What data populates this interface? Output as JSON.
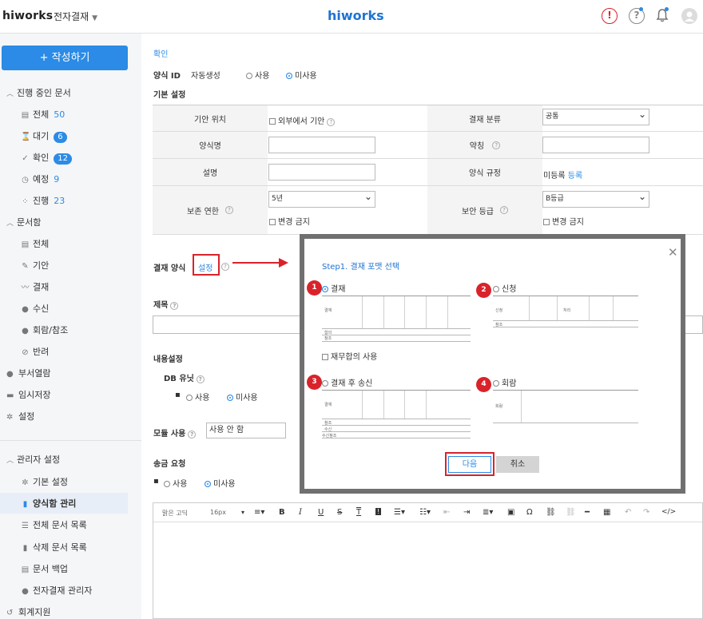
{
  "header": {
    "logo": "hiworks",
    "app_menu": "전자결재",
    "center_logo": "hiworks"
  },
  "sidebar": {
    "write_button": "+ 작성하기",
    "in_progress": {
      "title": "진행 중인 문서",
      "items": [
        {
          "label": "전체",
          "count": "50"
        },
        {
          "label": "대기",
          "count": "6"
        },
        {
          "label": "확인",
          "count": "12"
        },
        {
          "label": "예정",
          "count": "9"
        },
        {
          "label": "진행",
          "count": "23"
        }
      ]
    },
    "document_box": {
      "title": "문서함",
      "items": [
        "전체",
        "기안",
        "결재",
        "수신",
        "회람/참조",
        "반려"
      ]
    },
    "top_items": [
      "부서열람",
      "임시저장",
      "설정"
    ],
    "admin": {
      "title": "관리자 설정",
      "items": [
        "기본 설정",
        "양식함 관리",
        "전체 문서 목록",
        "삭제 문서 목록",
        "문서 백업",
        "전자결재 관리자"
      ]
    },
    "bottom_item": "회계지원"
  },
  "main": {
    "confirm_link": "확인",
    "form_id_label": "양식 ID",
    "form_id_auto": "자동생성",
    "use": "사용",
    "not_use": "미사용",
    "basic_settings": "기본 설정",
    "table": {
      "draft_location": "기안 위치",
      "external_draft": "외부에서 기안",
      "approval_category": "결재 분류",
      "approval_category_value": "공통",
      "form_name": "양식명",
      "abbreviation": "약칭",
      "description": "설명",
      "form_rule": "양식 규정",
      "unregistered": "미등록",
      "register": "등록",
      "retention": "보존 연한",
      "retention_value": "5년",
      "no_change": "변경 금지",
      "security": "보안 등급",
      "security_value": "B등급"
    },
    "approval_format": "결재 양식",
    "settings_link": "설정",
    "title_label": "제목",
    "content_settings": "내용설정",
    "db_unit": "DB 유닛",
    "module_use": "모듈 사용",
    "module_value": "사용 안 함",
    "remit_request": "송금 요청",
    "editor": {
      "font": "맑은 고딕",
      "size": "16px"
    }
  },
  "modal": {
    "title": "Step1. 결재 포맷 선택",
    "options": [
      {
        "num": "1",
        "label": "결재"
      },
      {
        "num": "2",
        "label": "신청"
      },
      {
        "num": "3",
        "label": "결재 후 송신"
      },
      {
        "num": "4",
        "label": "회람"
      }
    ],
    "financial_agreement": "재무합의 사용",
    "preview_labels": {
      "approval": "결재",
      "agreement": "합의",
      "reference": "참조",
      "apply": "신청",
      "process": "처리",
      "receive": "수신",
      "receive_ref": "수신참조",
      "circulate": "회람"
    },
    "next_button": "다음",
    "cancel_button": "취소"
  },
  "colors": {
    "accent": "#2b8be6",
    "highlight_red": "#d9232a",
    "modal_border": "#707070"
  }
}
